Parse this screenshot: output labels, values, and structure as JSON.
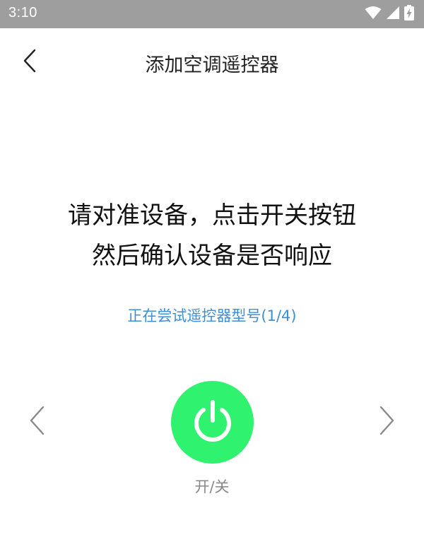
{
  "status_bar": {
    "time": "3:10",
    "icons": [
      "wifi-icon",
      "cellular-signal-icon",
      "battery-charging-icon"
    ]
  },
  "header": {
    "title": "添加空调遥控器",
    "back_icon": "chevron-left-icon"
  },
  "instruction": {
    "line1": "请对准设备，点击开关按钮",
    "line2": "然后确认设备是否响应"
  },
  "trying": {
    "text": "正在尝试遥控器型号(1/4)",
    "current": 1,
    "total": 4
  },
  "controls": {
    "prev_icon": "chevron-left-icon",
    "next_icon": "chevron-right-icon",
    "power_icon": "power-icon",
    "power_label": "开/关"
  },
  "colors": {
    "status_bar": "#9e9e9e",
    "accent_blue": "#3d8fd6",
    "power_green": "#2ff26f",
    "arrow_gray": "#8a8a8a",
    "label_gray": "#888888"
  }
}
